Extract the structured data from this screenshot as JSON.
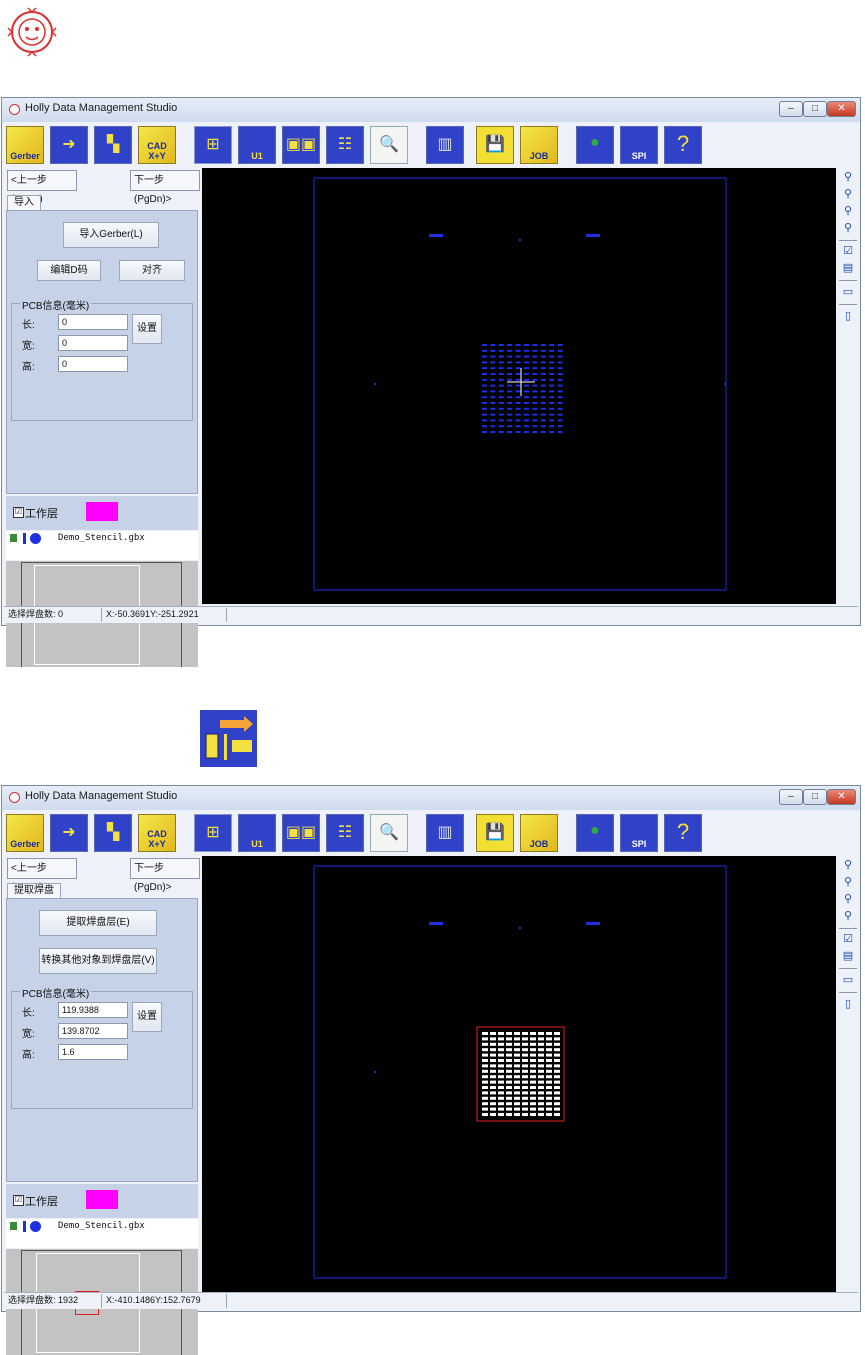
{
  "colors": {
    "canvas_bg": "#000000",
    "layer_blue": "#1d2fe0",
    "pad_white": "#ffffff",
    "highlight_red": "#e02020",
    "layer_magenta": "#ff00ff"
  },
  "logo": {
    "icon": "lion-head-logo-icon"
  },
  "toolbar_items": [
    {
      "label": "Gerber",
      "icon": "gerber-import-icon"
    },
    {
      "label": "",
      "icon": "extract-pads-icon"
    },
    {
      "label": "",
      "icon": "convert-objects-icon"
    },
    {
      "label": "CAD X+Y",
      "icon": "cad-import-icon"
    },
    {
      "label": "",
      "icon": "pad-layout-icon"
    },
    {
      "label": "U1",
      "icon": "component-icon"
    },
    {
      "label": "",
      "icon": "pad-pair-icon"
    },
    {
      "label": "",
      "icon": "pad-grid-icon"
    },
    {
      "label": "",
      "icon": "inspect-search-icon"
    },
    {
      "label": "",
      "icon": "machine-icon"
    },
    {
      "label": "",
      "icon": "save-disk-icon"
    },
    {
      "label": "JOB",
      "icon": "job-icon"
    },
    {
      "label": "",
      "icon": "globe-update-icon"
    },
    {
      "label": "SPI",
      "icon": "spi-icon"
    },
    {
      "label": "",
      "icon": "help-icon"
    }
  ],
  "rtools": [
    "zoom-in-icon",
    "zoom-out-icon",
    "zoom-fit-icon",
    "zoom-window-icon",
    "layer-check-icon",
    "layer-list-icon",
    "view-top-icon",
    "measure-icon"
  ],
  "screens": [
    {
      "title": "Holly Data Management Studio",
      "prev_button": "<上一步(PgUp)",
      "next_button": "下一步(PgDn)>",
      "tab": "导入",
      "action_primary": "导入Gerber(L)",
      "action_secondary": "编辑D码",
      "action_tertiary": "对齐",
      "pcb_group_title": "PCB信息(毫米)",
      "length_label": "长:",
      "width_label": "宽:",
      "height_label": "高:",
      "length_value": "0",
      "width_value": "0",
      "height_value": "0",
      "set_button": "设置",
      "working_layer_label": "工作层",
      "working_layer_checked": "☑",
      "file_name": "Demo_Stencil.gbx",
      "status_left": "选择焊盘数: 0",
      "status_coords": "X:-50.3691Y:-251.2921"
    },
    {
      "title": "Holly Data Management Studio",
      "prev_button": "<上一步(PgUp)",
      "next_button": "下一步(PgDn)>",
      "tab": "提取焊盘",
      "action_primary": "提取焊盘层(E)",
      "action_secondary": "转换其他对象到焊盘层(V)",
      "pcb_group_title": "PCB信息(毫米)",
      "length_label": "长:",
      "width_label": "宽:",
      "height_label": "高:",
      "length_value": "119.9388",
      "width_value": "139.8702",
      "height_value": "1.6",
      "set_button": "设置",
      "working_layer_label": "工作层",
      "working_layer_checked": "☑",
      "file_name": "Demo_Stencil.gbx",
      "status_left": "选择焊盘数: 1932",
      "status_coords": "X:-410.1486Y:152.7679"
    }
  ],
  "step_icon": "extract-pads-icon"
}
